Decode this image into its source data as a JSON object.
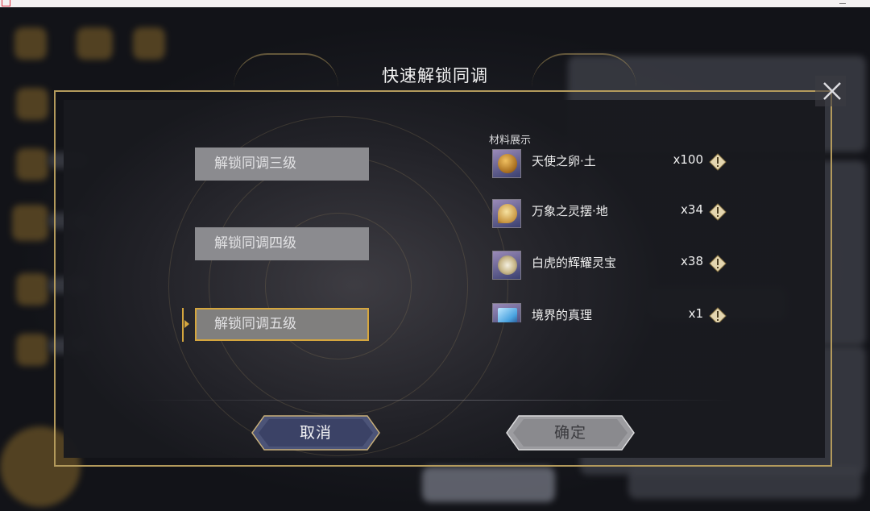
{
  "dialog": {
    "title": "快速解锁同调",
    "close_icon": "close-x-icon"
  },
  "options": [
    {
      "label": "解锁同调三级",
      "selected": false
    },
    {
      "label": "解锁同调四级",
      "selected": false
    },
    {
      "label": "解锁同调五级",
      "selected": true
    }
  ],
  "materials": {
    "heading": "材料展示",
    "items": [
      {
        "name": "天使之卵·土",
        "qty": "x100",
        "icon": "angel-egg-icon"
      },
      {
        "name": "万象之灵摆·地",
        "qty": "x34",
        "icon": "pendulum-icon"
      },
      {
        "name": "白虎的辉耀灵宝",
        "qty": "x38",
        "icon": "white-tiger-treasure-icon"
      },
      {
        "name": "境界的真理",
        "qty": "x1",
        "icon": "crystal-icon"
      }
    ]
  },
  "buttons": {
    "cancel": "取消",
    "confirm": "确定"
  },
  "colors": {
    "accent_gold": "#d5a63e",
    "frame_gold": "#b39a5c",
    "option_bg": "#8b8b8f"
  }
}
